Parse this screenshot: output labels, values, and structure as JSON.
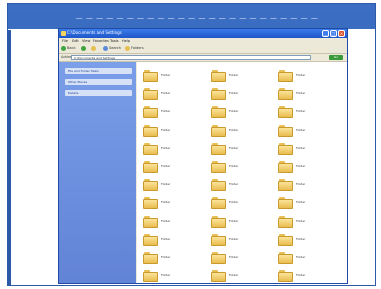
{
  "slide": {
    "title": "— — — — — — — — — — — — — — — — — — — — — — — —"
  },
  "window": {
    "title": "C:\\Documents and Settings",
    "buttons": {
      "minimize": "_",
      "maximize": "□",
      "close": "×"
    },
    "menu": [
      "File",
      "Edit",
      "View",
      "Favorites",
      "Tools",
      "Help"
    ],
    "toolbar": {
      "back": "Back",
      "forward": "→",
      "up": "↑",
      "search": "Search",
      "folders": "Folders"
    },
    "address": {
      "label": "Address",
      "value": "C:\\Documents and Settings",
      "go": "Go"
    }
  },
  "taskpane": {
    "items": [
      "File and Folder Tasks",
      "Other Places",
      "Details"
    ]
  },
  "files": {
    "items": [
      "Folder",
      "Folder",
      "Folder",
      "Folder",
      "Folder",
      "Folder",
      "Folder",
      "Folder",
      "Folder",
      "Folder",
      "Folder",
      "Folder",
      "Folder",
      "Folder",
      "Folder",
      "Folder",
      "Folder",
      "Folder",
      "Folder",
      "Folder",
      "Folder",
      "Folder",
      "Folder",
      "Folder",
      "Folder",
      "Folder",
      "Folder",
      "Folder",
      "Folder",
      "Folder",
      "Folder",
      "Folder",
      "Folder",
      "Folder",
      "Folder",
      "Folder"
    ]
  }
}
